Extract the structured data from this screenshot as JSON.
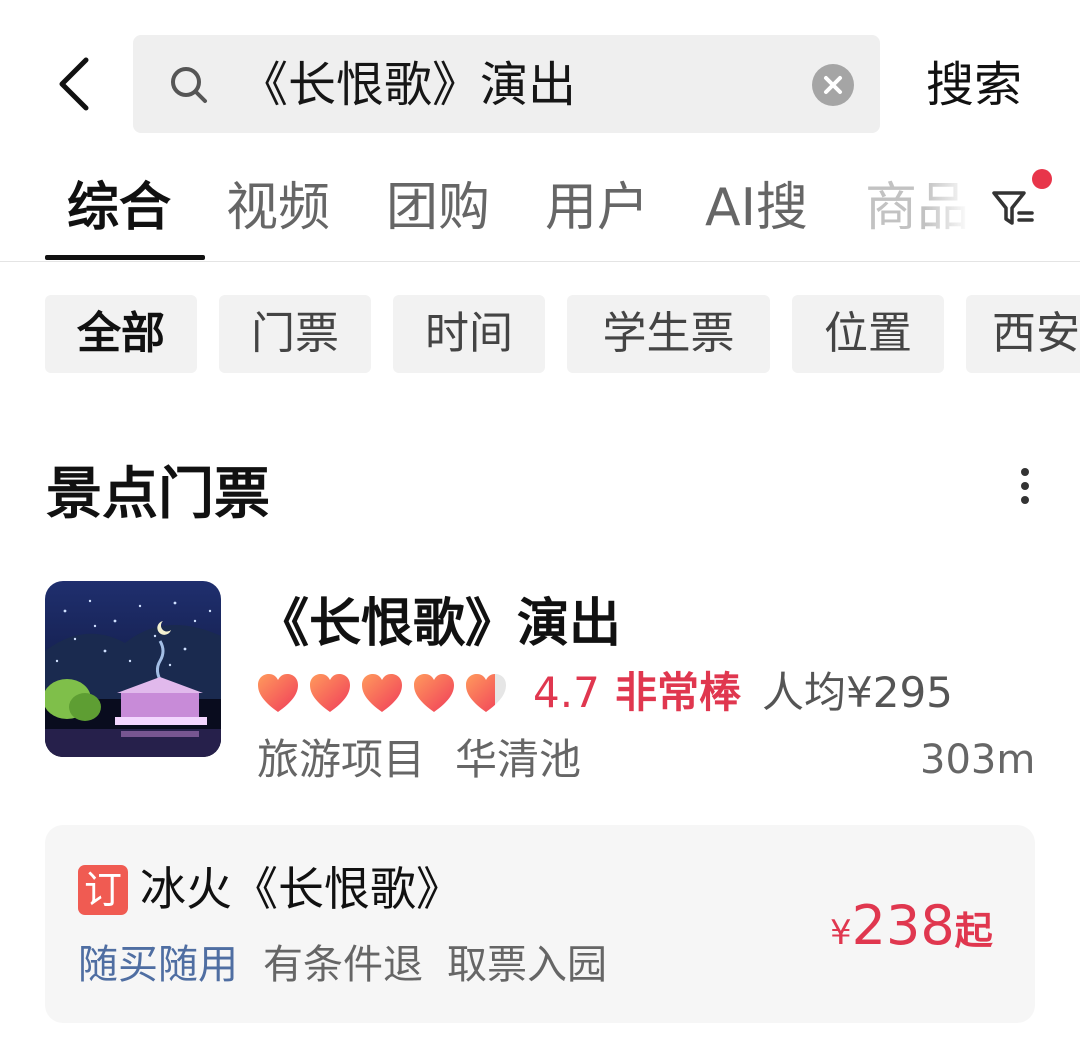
{
  "header": {
    "back_icon": "chevron-left-icon",
    "search_query": "《长恨歌》演出",
    "clear_icon": "clear-circle-icon",
    "search_button": "搜索"
  },
  "tabs": [
    {
      "label": "综合",
      "active": true
    },
    {
      "label": "视频"
    },
    {
      "label": "团购"
    },
    {
      "label": "用户"
    },
    {
      "label": "AI搜"
    },
    {
      "label": "商品"
    }
  ],
  "filter": {
    "icon": "filter-icon",
    "has_notification_dot": true
  },
  "chips": [
    "全部",
    "门票",
    "时间",
    "学生票",
    "位置",
    "西安"
  ],
  "section": {
    "title": "景点门票",
    "more_icon": "more-vertical-icon"
  },
  "result": {
    "title": "《长恨歌》演出",
    "rating": {
      "hearts": 5,
      "score": "4.7",
      "label": "非常棒"
    },
    "avg_price": "人均¥295",
    "category": "旅游项目",
    "location": "华清池",
    "distance": "303m"
  },
  "ticket": {
    "badge": "订",
    "name": "冰火《长恨歌》",
    "tags": [
      "随买随用",
      "有条件退",
      "取票入园"
    ],
    "price_currency": "¥",
    "price_value": "238",
    "price_suffix": "起"
  },
  "colors": {
    "accent_red": "#e0374f",
    "badge_red": "#f05b52",
    "tag_blue": "#4f6ea2",
    "text_primary": "#111111",
    "text_secondary": "#666666"
  }
}
